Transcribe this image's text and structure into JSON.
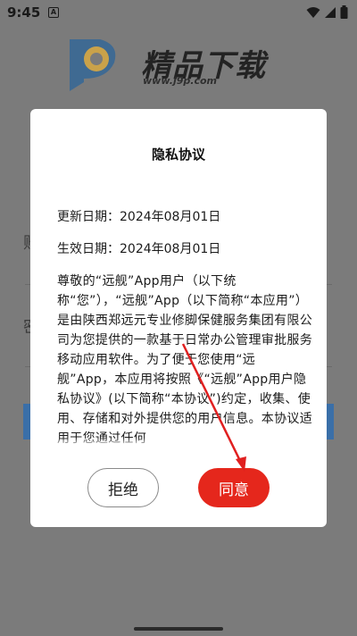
{
  "status_bar": {
    "time": "9:45",
    "notification_letter": "A",
    "icons": [
      "wifi-icon",
      "signal-icon",
      "battery-icon"
    ]
  },
  "background": {
    "brand": "精品下载",
    "url": "www.j9p.com",
    "fragment_1": "账",
    "fragment_2": "密"
  },
  "dialog": {
    "title": "隐私协议",
    "updated": "更新日期：2024年08月01日",
    "effective": "生效日期：2024年08月01日",
    "paragraph": "尊敬的“远舰”App用户（以下统称“您”），“远舰”App（以下简称“本应用”）是由陕西郑远元专业修脚保健服务集团有限公司为您提供的一款基于日常办公管理审批服务移动应用软件。为了便于您使用“远舰”App，本应用将按照《“远舰”App用户隐私协议》(以下简称“本协议”)约定，收集、使用、存储和对外提供您的用户信息。本协议适用于您通过任何",
    "reject_label": "拒绝",
    "agree_label": "同意"
  },
  "colors": {
    "overlay": "#7b7b7b",
    "agree": "#e5271c",
    "annotation_arrow": "#e02020"
  }
}
